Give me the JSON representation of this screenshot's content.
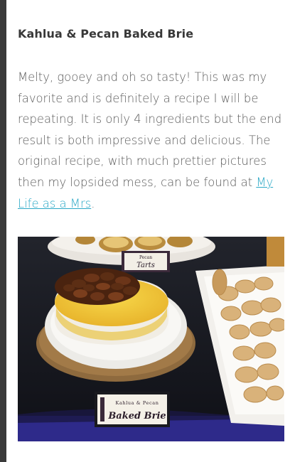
{
  "post": {
    "title": "Kahlua & Pecan Baked Brie",
    "body_text": "Melty, gooey and oh so tasty! This was my favorite and is definitely a recipe I will be repeating. It is only 4 ingredients but the end result is both impressive and delicious.  The original recipe, with much prettier pictures then my lopsided mess, can be found at ",
    "link_text": "My Life as a Mrs",
    "after_link": "."
  },
  "photo": {
    "tarts_label": "Tarts",
    "tarts_small": "Pecan",
    "brie_small": "Kahlua & Pecan",
    "brie_label": "Baked Brie"
  },
  "colors": {
    "link": "#2aa8c6",
    "title": "#383838",
    "body": "#5a5a5a",
    "left_bar": "#3a3a3a"
  }
}
